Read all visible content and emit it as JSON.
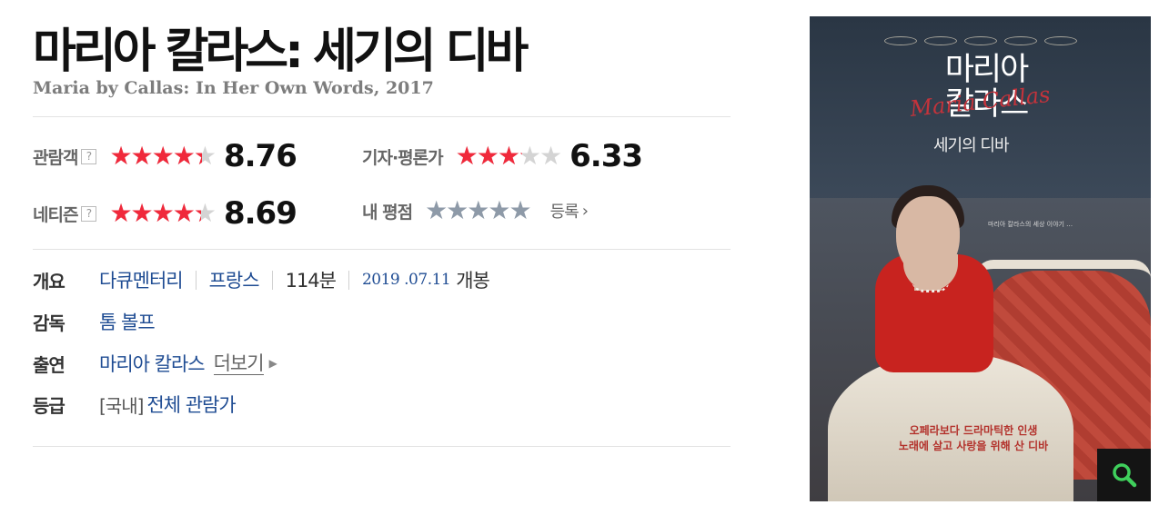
{
  "movie": {
    "title": "마리아 칼라스: 세기의 디바",
    "original_title_year": "Maria by Callas: In Her Own Words, 2017"
  },
  "ratings": {
    "help_icon": "question-mark-icon",
    "audience": {
      "label": "관람객",
      "score": "8.76",
      "fill_fraction": 0.876
    },
    "critic": {
      "label": "기자·평론가",
      "score": "6.33",
      "fill_fraction": 0.633
    },
    "netizen": {
      "label": "네티즌",
      "score": "8.69",
      "fill_fraction": 0.869
    },
    "mine": {
      "label": "내 평점",
      "register_label": "등록",
      "register_icon": "chevron-right-icon"
    },
    "star_colors": {
      "filled": "#f0293b",
      "empty": "#d4d4d4",
      "mine": "#8e9aa8"
    }
  },
  "info": {
    "overview": {
      "label": "개요",
      "genre": "다큐멘터리",
      "country": "프랑스",
      "runtime": "114분",
      "release_date": "2019 .07.11",
      "release_suffix": "개봉"
    },
    "director": {
      "label": "감독",
      "name": "톰 볼프"
    },
    "cast": {
      "label": "출연",
      "name": "마리아 칼라스",
      "more_label": "더보기"
    },
    "grade": {
      "label": "등급",
      "prefix": "[국내]",
      "value": "전체 관람가"
    }
  },
  "poster": {
    "title_line1": "마리아",
    "title_line2": "칼라스",
    "signature": "Maria Callas",
    "subtitle": "세기의 디바",
    "small_text": "마리아 칼라스의 세상 이야기 …",
    "tagline_line1": "오페라보다 드라마틱한 인생",
    "tagline_line2": "노래에 살고 사랑을 위해 산 디바",
    "zoom_icon": "magnifier-icon",
    "zoom_icon_color": "#3fcf5c"
  }
}
